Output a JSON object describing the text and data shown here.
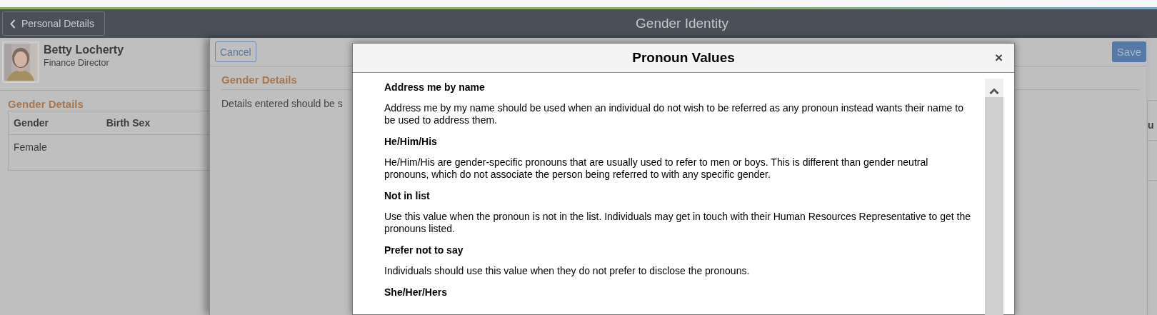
{
  "header": {
    "back_button": "Personal Details",
    "title": "Gender Identity"
  },
  "profile": {
    "name": "Betty Locherty",
    "job_title": "Finance Director"
  },
  "section": {
    "title": "Gender Details",
    "table": {
      "columns": [
        "Gender",
        "Birth Sex"
      ],
      "rows": [
        [
          "Female"
        ]
      ]
    },
    "cut_column": "u"
  },
  "panel": {
    "cancel_button": "Cancel",
    "save_button": "Save",
    "section_title": "Gender Details",
    "description": "Details entered should be s"
  },
  "dialog": {
    "title": "Pronoun Values",
    "close": "×",
    "entries": [
      {
        "title": "Address me by name",
        "description": "Address me by my name should be used when an individual do not wish to be referred as any pronoun instead wants their name to be used to address them."
      },
      {
        "title": "He/Him/His",
        "description": "He/Him/His are gender-specific pronouns that are usually used to refer to men or boys. This is different than gender neutral pronouns, which do not associate the person being referred to with any specific gender."
      },
      {
        "title": "Not in list",
        "description": "Use this value when the pronoun is not in the list. Individuals may get in touch with their Human Resources Representative to get the pronouns listed."
      },
      {
        "title": "Prefer not to say",
        "description": "Individuals should use this value when they do not prefer to disclose the pronouns."
      },
      {
        "title": "She/Her/Hers"
      }
    ]
  }
}
